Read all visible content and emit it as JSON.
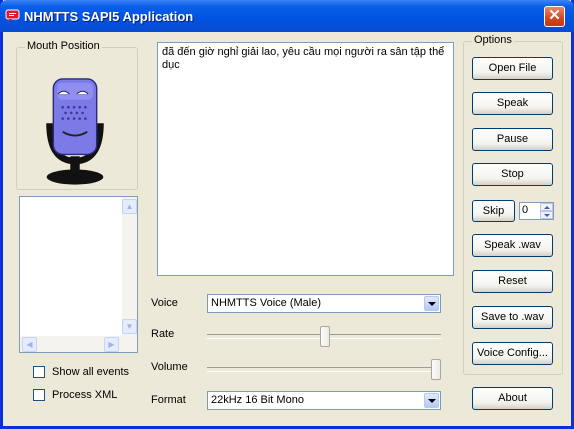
{
  "window": {
    "title": "NHMTTS SAPI5 Application",
    "close_symbol": "✕"
  },
  "mouth_group": {
    "label": "Mouth Position"
  },
  "text_content": "đã đến giờ nghỉ giải lao, yêu cầu mọi người ra sân tập thể dục",
  "options_group": {
    "label": "Options",
    "buttons": {
      "open_file": "Open File",
      "speak": "Speak",
      "pause": "Pause",
      "stop": "Stop",
      "skip": "Skip",
      "speak_wav": "Speak .wav",
      "reset": "Reset",
      "save_to_wav": "Save to .wav",
      "voice_config": "Voice Config..."
    },
    "skip_value": "0"
  },
  "about_button": "About",
  "controls": {
    "voice_label": "Voice",
    "voice_value": "NHMTTS Voice (Male)",
    "rate_label": "Rate",
    "rate_level": 0.5,
    "volume_label": "Volume",
    "volume_level": 1.0,
    "format_label": "Format",
    "format_value": "22kHz 16 Bit Mono"
  },
  "checkboxes": {
    "show_all_events": "Show all events",
    "process_xml": "Process XML"
  }
}
